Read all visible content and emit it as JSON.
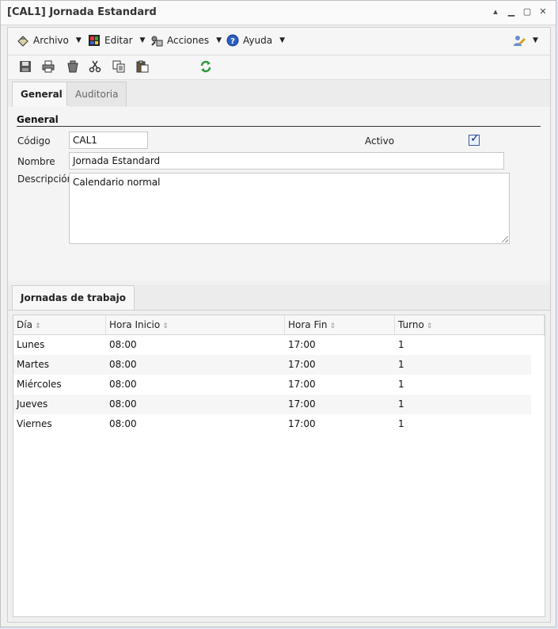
{
  "window": {
    "title": "[CAL1] Jornada Estandard",
    "controls": [
      "▴",
      "▁",
      "▢",
      "✕"
    ]
  },
  "menubar": {
    "items": [
      {
        "label": "Archivo",
        "icon": "archive-icon"
      },
      {
        "label": "Editar",
        "icon": "edit-grid-icon"
      },
      {
        "label": "Acciones",
        "icon": "actions-icon"
      },
      {
        "label": "Ayuda",
        "icon": "help-icon"
      }
    ],
    "user_icon": "user-pencil-icon"
  },
  "toolbar": {
    "tools": [
      "save-icon",
      "print-icon",
      "delete-icon",
      "cut-icon",
      "copy-icon",
      "paste-icon",
      "refresh-icon"
    ]
  },
  "tabs": [
    {
      "label": "General"
    },
    {
      "label": "Auditoria"
    }
  ],
  "form": {
    "section_title": "General",
    "codigo_label": "Código",
    "codigo_value": "CAL1",
    "activo_label": "Activo",
    "activo_checked": true,
    "nombre_label": "Nombre",
    "nombre_value": "Jornada Estandard",
    "descripcion_label": "Descripción",
    "descripcion_value": "Calendario normal"
  },
  "lower": {
    "tab_label": "Jornadas de trabajo",
    "columns": [
      "Día",
      "Hora Inicio",
      "Hora Fin",
      "Turno"
    ],
    "rows": [
      [
        "Lunes",
        "08:00",
        "17:00",
        "1"
      ],
      [
        "Martes",
        "08:00",
        "17:00",
        "1"
      ],
      [
        "Miércoles",
        "08:00",
        "17:00",
        "1"
      ],
      [
        "Jueves",
        "08:00",
        "17:00",
        "1"
      ],
      [
        "Viernes",
        "08:00",
        "17:00",
        "1"
      ]
    ]
  },
  "colors": {
    "accent_check": "#0a2a7a",
    "refresh_green": "#2a9a3a",
    "help_blue": "#2a5fbf"
  }
}
